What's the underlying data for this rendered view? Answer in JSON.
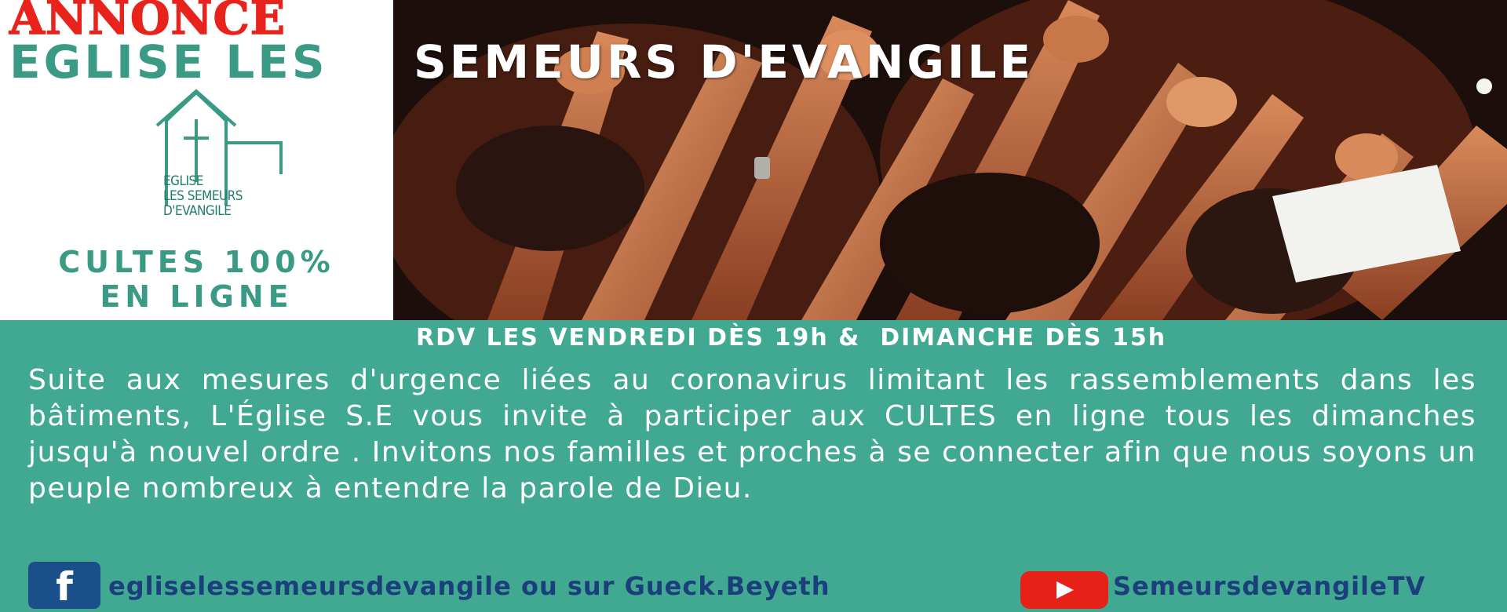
{
  "header": {
    "annonce": "ANNONCE",
    "title_left": "EGLISE LES",
    "title_right": "SEMEURS D'EVANGILE"
  },
  "logo": {
    "lines": [
      "EGLISE",
      "LES SEMEURS",
      "D'EVANGILE"
    ],
    "color": "#3a9a85"
  },
  "cultes": {
    "line1": "CULTES 100%",
    "line2": "EN LIGNE"
  },
  "schedule": {
    "text": "RDV LES VENDREDI DÈS 19h &  DIMANCHE DÈS 15h"
  },
  "body": {
    "text": "Suite aux mesures d'urgence liées au coronavirus limitant les rassemblements dans les bâtiments, L'Église S.E vous invite à participer aux CULTES en ligne tous les dimanches jusqu'à nouvel ordre . Invitons nos familles et proches à se connecter afin que nous soyons un peuple nombreux à entendre la parole de Dieu."
  },
  "social": {
    "facebook": {
      "icon": "facebook-icon",
      "glyph": "f",
      "text": "egliselessemeursdevangile ou sur Gueck.Beyeth",
      "color": "#1b4f8a"
    },
    "youtube": {
      "icon": "youtube-icon",
      "text": "SemeursdevangileTV",
      "color": "#e62117"
    }
  },
  "colors": {
    "teal": "#41a992",
    "red": "#e8231c",
    "navy": "#1b3f7a"
  }
}
